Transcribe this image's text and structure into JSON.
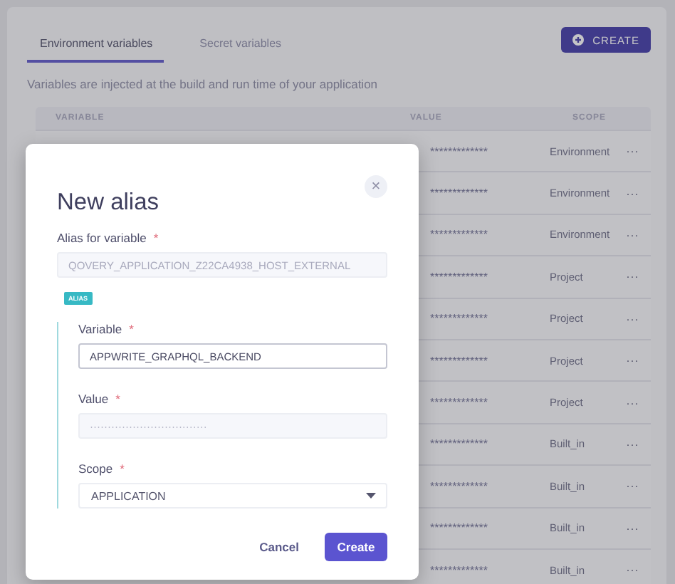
{
  "tabs": [
    {
      "label": "Environment variables",
      "selected": true
    },
    {
      "label": "Secret variables",
      "selected": false
    }
  ],
  "create_button": {
    "label": "CREATE"
  },
  "description": "Variables are injected at the build and run time of your application",
  "table": {
    "columns": [
      "VARIABLE",
      "VALUE",
      "SCOPE"
    ],
    "rows": [
      {
        "value": "*************",
        "scope": "Environment",
        "menu": "···"
      },
      {
        "value": "*************",
        "scope": "Environment",
        "menu": "···"
      },
      {
        "value": "*************",
        "scope": "Environment",
        "menu": "···"
      },
      {
        "value": "*************",
        "scope": "Project",
        "menu": "···"
      },
      {
        "value": "*************",
        "scope": "Project",
        "menu": "···"
      },
      {
        "value": "*************",
        "scope": "Project",
        "menu": "···"
      },
      {
        "value": "*************",
        "scope": "Project",
        "menu": "···"
      },
      {
        "value": "*************",
        "scope": "Built_in",
        "menu": "···"
      },
      {
        "value": "*************",
        "scope": "Built_in",
        "menu": "···"
      },
      {
        "value": "*************",
        "scope": "Built_in",
        "menu": "···"
      },
      {
        "value": "*************",
        "scope": "Built_in",
        "menu": "···"
      }
    ]
  },
  "dialog": {
    "title": "New alias",
    "close": "×",
    "alias_for": {
      "label": "Alias for variable",
      "required": "*",
      "value": "QOVERY_APPLICATION_Z22CA4938_HOST_EXTERNAL",
      "disabled": true
    },
    "badge": "ALIAS",
    "variable": {
      "label": "Variable",
      "required": "*",
      "value": "APPWRITE_GRAPHQL_BACKEND",
      "disabled": false
    },
    "value": {
      "label": "Value",
      "required": "*",
      "value": "·································",
      "disabled": true
    },
    "scope": {
      "label": "Scope",
      "required": "*",
      "value": "APPLICATION"
    },
    "buttons": {
      "cancel": "Cancel",
      "create": "Create"
    }
  }
}
